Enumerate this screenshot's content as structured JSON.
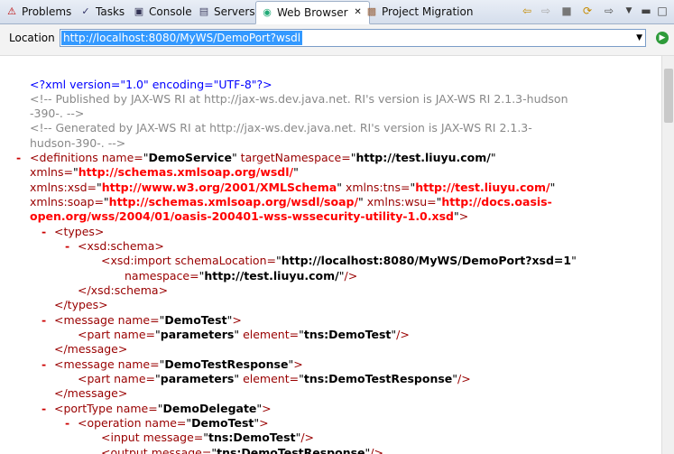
{
  "tabs": [
    {
      "label": "Problems",
      "icon": "problems-icon"
    },
    {
      "label": "Tasks",
      "icon": "tasks-icon"
    },
    {
      "label": "Console",
      "icon": "console-icon"
    },
    {
      "label": "Servers",
      "icon": "servers-icon"
    },
    {
      "label": "Web Browser",
      "icon": "web-browser-icon",
      "active": true
    },
    {
      "label": "Project Migration",
      "icon": "project-migration-icon"
    }
  ],
  "location": {
    "label": "Location",
    "url": "http://localhost:8080/MyWS/DemoPort?wsdl"
  },
  "xml": {
    "decl": "<?xml version=\"1.0\" encoding=\"UTF-8\"?>",
    "comment1a": "<!-- Published by JAX-WS RI at http://jax-ws.dev.java.net. RI's version is JAX-WS RI 2.1.3-hudson",
    "comment1b": "-390-. -->",
    "comment2a": "<!-- Generated by JAX-WS RI at http://jax-ws.dev.java.net. RI's version is JAX-WS RI 2.1.3-",
    "comment2b": "hudson-390-. -->",
    "collapse": "-",
    "definitions": {
      "tag": "<definitions",
      "name": "DemoService",
      "tns": "http://test.liuyu.com/"
    },
    "xmlns": "http://schemas.xmlsoap.org/wsdl/",
    "xsd": "http://www.w3.org/2001/XMLSchema",
    "tns": "http://test.liuyu.com/",
    "soap": "http://schemas.xmlsoap.org/wsdl/soap/",
    "wsu_a": "http://docs.oasis-",
    "wsu_b": "open.org/wss/2004/01/oasis-200401-wss-wssecurity-utility-1.0.xsd",
    "import_loc": "http://localhost:8080/MyWS/DemoPort?xsd=1",
    "import_ns": "http://test.liuyu.com/",
    "msg1": "DemoTest",
    "part1_name": "parameters",
    "part1_el": "tns:DemoTest",
    "msg2": "DemoTestResponse",
    "part2_name": "parameters",
    "part2_el": "tns:DemoTestResponse",
    "porttype": "DemoDelegate",
    "op": "DemoTest",
    "input_msg": "tns:DemoTest",
    "output_msg": "tns:DemoTestResponse"
  }
}
